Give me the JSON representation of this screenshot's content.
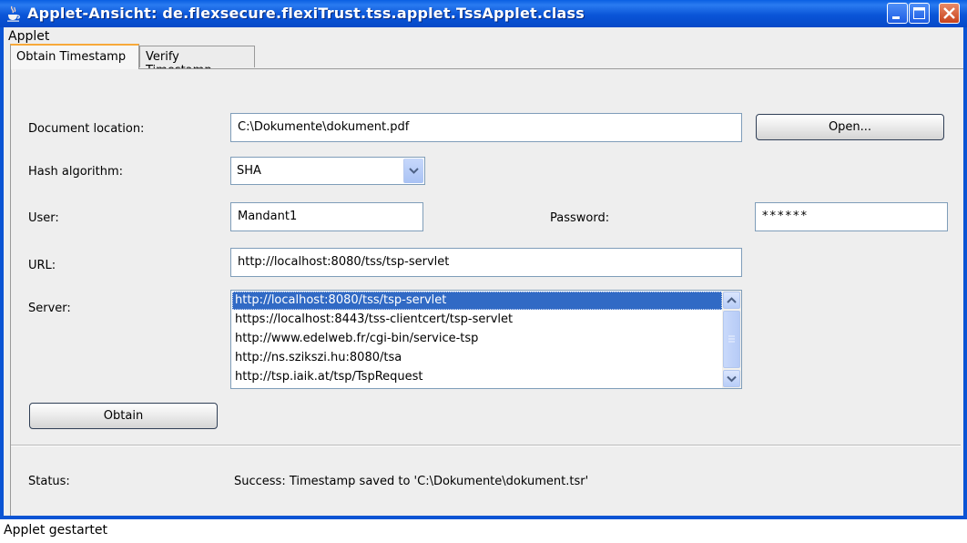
{
  "window": {
    "title": "Applet-Ansicht: de.flexsecure.flexiTrust.tss.applet.TssApplet.class",
    "app_icon": "java-cup-icon",
    "controls": [
      "minimize-icon",
      "maximize-icon",
      "close-icon"
    ]
  },
  "menu": {
    "items": [
      {
        "label": "Applet"
      }
    ]
  },
  "tabs": [
    {
      "label": "Obtain Timestamp",
      "active": true
    },
    {
      "label": "Verify Timestamp",
      "active": false
    }
  ],
  "form": {
    "document_location": {
      "label": "Document location:",
      "value": "C:\\Dokumente\\dokument.pdf"
    },
    "open_button": "Open...",
    "hash_algorithm": {
      "label": "Hash algorithm:",
      "value": "SHA"
    },
    "user": {
      "label": "User:",
      "value": "Mandant1"
    },
    "password": {
      "label": "Password:",
      "value": "******"
    },
    "url": {
      "label": "URL:",
      "value": "http://localhost:8080/tss/tsp-servlet"
    },
    "server": {
      "label": "Server:",
      "items": [
        "http://localhost:8080/tss/tsp-servlet",
        "https://localhost:8443/tss-clientcert/tsp-servlet",
        "http://www.edelweb.fr/cgi-bin/service-tsp",
        "http://ns.szikszi.hu:8080/tsa",
        "http://tsp.iaik.at/tsp/TspRequest"
      ],
      "selected_index": 0
    },
    "obtain_button": "Obtain",
    "status": {
      "label": "Status:",
      "value": "Success: Timestamp saved to 'C:\\Dokumente\\dokument.tsr'"
    }
  },
  "statusbar": {
    "text": "Applet gestartet"
  },
  "colors": {
    "titlebar": "#0a55d8",
    "selection": "#316ac5",
    "active_tab_accent": "#f7a93a",
    "panel_bg": "#eeeeee"
  }
}
